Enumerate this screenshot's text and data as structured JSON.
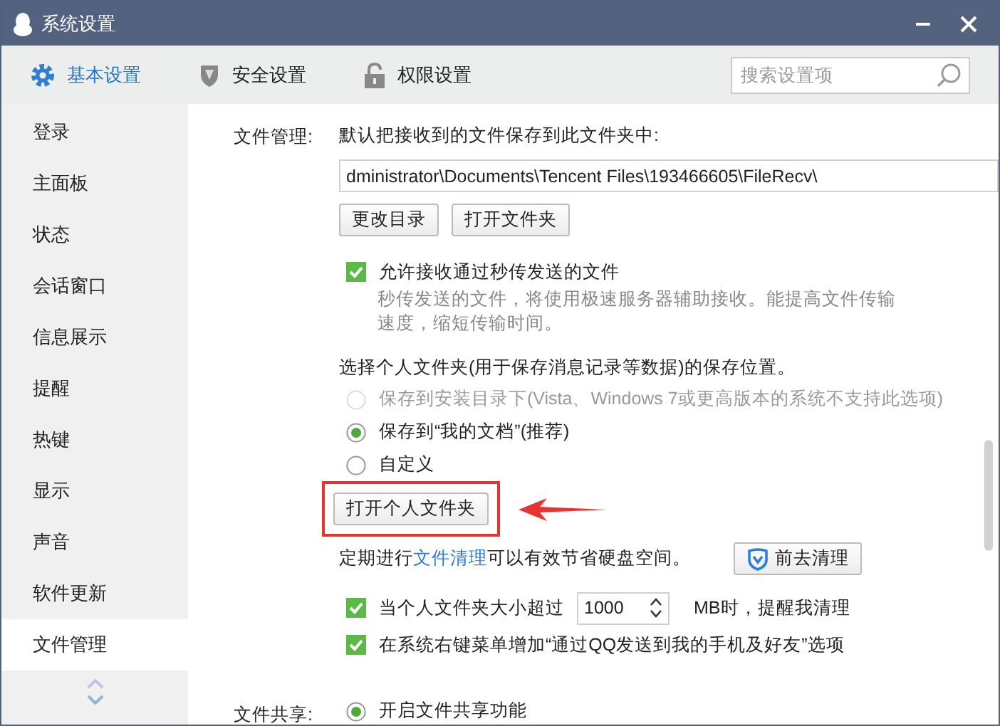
{
  "window": {
    "title": "系统设置"
  },
  "tabs": [
    {
      "label": "基本设置",
      "selected": true,
      "kind": "gear"
    },
    {
      "label": "安全设置",
      "selected": false,
      "kind": "shield"
    },
    {
      "label": "权限设置",
      "selected": false,
      "kind": "lock"
    }
  ],
  "search": {
    "placeholder": "搜索设置项"
  },
  "sidebar": {
    "items": [
      {
        "label": "登录",
        "selected": false
      },
      {
        "label": "主面板",
        "selected": false
      },
      {
        "label": "状态",
        "selected": false
      },
      {
        "label": "会话窗口",
        "selected": false
      },
      {
        "label": "信息展示",
        "selected": false
      },
      {
        "label": "提醒",
        "selected": false
      },
      {
        "label": "热键",
        "selected": false
      },
      {
        "label": "显示",
        "selected": false
      },
      {
        "label": "声音",
        "selected": false
      },
      {
        "label": "软件更新",
        "selected": false
      },
      {
        "label": "文件管理",
        "selected": true
      }
    ]
  },
  "file_management": {
    "label": "文件管理:",
    "intro": "默认把接收到的文件保存到此文件夹中:",
    "path": "dministrator\\Documents\\Tencent Files\\193466605\\FileRecv\\",
    "buttons": [
      "更改目录",
      "打开文件夹"
    ],
    "fast_transfer": {
      "label": "允许接收通过秒传发送的文件",
      "checked": true,
      "description": "秒传发送的文件，将使用极速服务器辅助接收。能提高文件传输速度，缩短传输时间。"
    },
    "personal_folder": {
      "heading": "选择个人文件夹(用于保存消息记录等数据)的保存位置。",
      "options": [
        {
          "label": "保存到安装目录下(Vista、Windows 7或更高版本的系统不支持此选项)",
          "selected": false,
          "disabled": true
        },
        {
          "label": "保存到“我的文档”(推荐)",
          "selected": true,
          "disabled": false
        },
        {
          "label": "自定义",
          "selected": false,
          "disabled": false
        }
      ],
      "open_button": "打开个人文件夹",
      "highlighted": true
    },
    "cleanup": {
      "before": "定期进行",
      "link": "文件清理",
      "after": "可以有效节省硬盘空间。",
      "button": "前去清理"
    },
    "size_alert": {
      "before": "当个人文件夹大小超过",
      "value": "1000",
      "after": "MB时，提醒我清理",
      "checked": true
    },
    "context_menu": {
      "label": "在系统右键菜单增加“通过QQ发送到我的手机及好友”选项",
      "checked": true
    }
  },
  "file_sharing": {
    "label": "文件共享:",
    "options": [
      {
        "label": "开启文件共享功能",
        "selected": true
      }
    ]
  }
}
